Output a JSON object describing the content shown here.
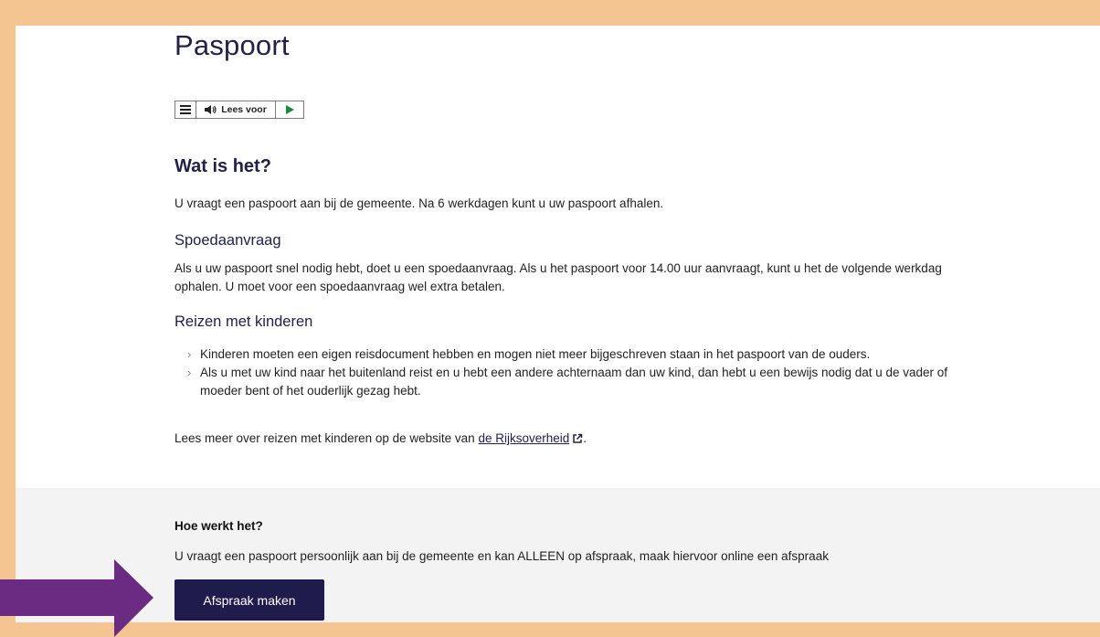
{
  "page": {
    "title": "Paspoort"
  },
  "readspeaker": {
    "menu_icon": "menu-icon",
    "speaker_icon": "speaker-icon",
    "label": "Lees voor",
    "play_icon": "play-icon"
  },
  "section_what": {
    "heading": "Wat is het?",
    "intro": "U vraagt een paspoort aan bij de gemeente. Na 6 werkdagen kunt u uw paspoort afhalen."
  },
  "section_urgent": {
    "heading": "Spoedaanvraag",
    "text": "Als u uw paspoort snel nodig hebt, doet u een spoedaanvraag. Als u het paspoort voor 14.00 uur aanvraagt, kunt u het de volgende werkdag ophalen. U moet voor een spoedaanvraag wel extra betalen."
  },
  "section_children": {
    "heading": "Reizen met kinderen",
    "items": [
      "Kinderen moeten een eigen reisdocument hebben en mogen niet meer bijgeschreven staan in het paspoort van de ouders.",
      "Als u met uw kind naar het buitenland reist en u hebt een andere achternaam dan uw kind, dan hebt u een bewijs nodig dat u de vader of moeder bent of het ouderlijk gezag hebt."
    ],
    "more_prefix": "Lees meer over reizen met kinderen op de website van",
    "more_link": "de Rijksoverheid",
    "more_suffix": "."
  },
  "how": {
    "heading": "Hoe werkt het?",
    "text": "U vraagt een paspoort persoonlijk aan bij de gemeente en kan ALLEEN op afspraak, maak hiervoor online een afspraak",
    "button": "Afspraak maken"
  },
  "colors": {
    "frame": "#f4c590",
    "brand": "#1f1b4d",
    "arrow": "#6c2b82",
    "grey_section": "#f3f3f3"
  }
}
